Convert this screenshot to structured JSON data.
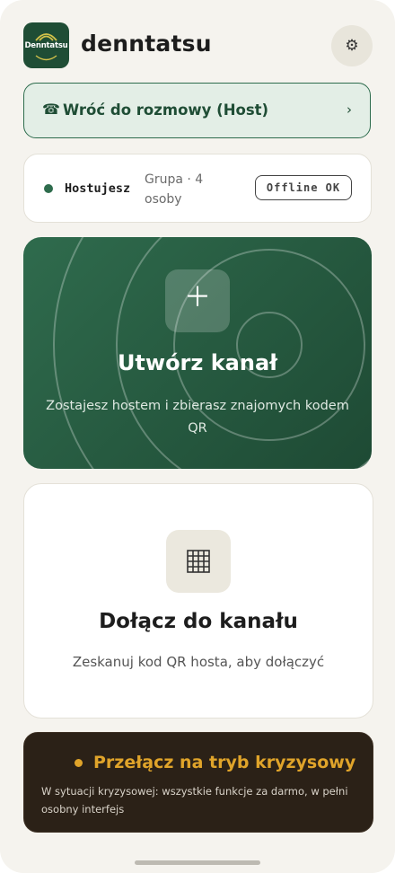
{
  "app": {
    "name": "denntatsu",
    "logo_text": "Denntatsu"
  },
  "header": {
    "settings_icon": "gear-icon"
  },
  "back_call": {
    "icon": "phone-icon",
    "label": "Wróć do rozmowy (Host)",
    "chevron": "›"
  },
  "status": {
    "role": "Hostujesz",
    "group": "Grupa · 4 osoby",
    "badge": "Offline OK",
    "dot_color": "#2e6c4d"
  },
  "create_channel": {
    "icon": "plus-icon",
    "title": "Utwórz kanał",
    "description": "Zostajesz hostem i zbierasz znajomych kodem QR"
  },
  "join_channel": {
    "icon": "qr-grid-icon",
    "title": "Dołącz do kanału",
    "description": "Zeskanuj kod QR hosta, aby dołączyć"
  },
  "crisis_mode": {
    "title": "Przełącz na tryb kryzysowy",
    "description": "W sytuacji kryzysowej: wszystkie funkcje za darmo, w pełni osobny interfejs",
    "accent": "#e0a42a"
  },
  "colors": {
    "brand_green": "#1f4d35",
    "background": "#f5f3ee",
    "crisis_bg": "#2b2117"
  }
}
